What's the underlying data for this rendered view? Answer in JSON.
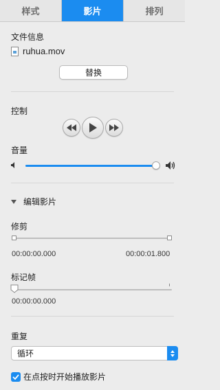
{
  "tabs": [
    {
      "label": "样式",
      "active": false
    },
    {
      "label": "影片",
      "active": true
    },
    {
      "label": "排列",
      "active": false
    }
  ],
  "file_info": {
    "heading": "文件信息",
    "file_name": "ruhua.mov",
    "replace_label": "替换"
  },
  "control": {
    "heading": "控制"
  },
  "volume": {
    "heading": "音量",
    "level": 1.0
  },
  "edit_movie": {
    "heading": "编辑影片",
    "expanded": true
  },
  "trim": {
    "heading": "修剪",
    "start_time": "00:00:00.000",
    "end_time": "00:00:01.800"
  },
  "poster_frame": {
    "heading": "标记帧",
    "time": "00:00:00.000"
  },
  "repeat": {
    "heading": "重复",
    "selected": "循环"
  },
  "autoplay": {
    "label": "在点按时开始播放影片",
    "checked": true
  },
  "colors": {
    "accent": "#1b8cf0",
    "background": "#ececec"
  },
  "icons": [
    "file-icon",
    "rewind-icon",
    "play-icon",
    "fast-forward-icon",
    "volume-low-icon",
    "volume-high-icon",
    "disclosure-triangle-icon",
    "checkmark-icon",
    "select-arrows-icon"
  ]
}
